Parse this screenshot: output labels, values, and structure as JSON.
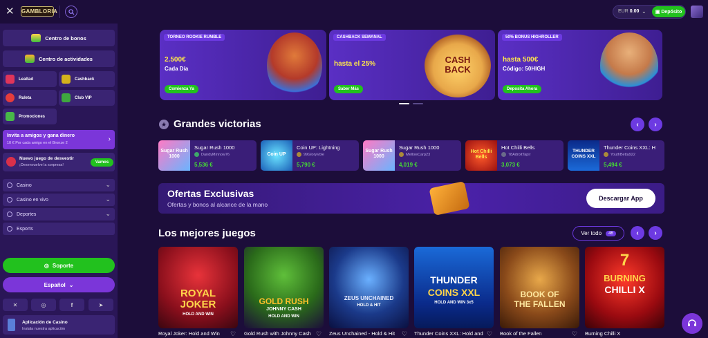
{
  "header": {
    "logo": "GAMBLORIA",
    "balance_label": "EUR",
    "balance_value": "0.00",
    "deposit_label": "Depósito"
  },
  "sidebar": {
    "bonus_center": "Centro de bonos",
    "activity_center": "Centro de actividades",
    "tiles": [
      "Lealtad",
      "Cashback",
      "Ruleta",
      "Club VIP",
      "Promociones"
    ],
    "invite_title": "Invita a amigos y gana dinero",
    "invite_sub": "10 € Por cada amigo en el Bronze 2",
    "wheel_title": "Nuevo juego de desvestir",
    "wheel_sub": "¡Desenvuelve la sorpresa!",
    "wheel_button": "Vamos",
    "menu": [
      "Casino",
      "Casino en vivo",
      "Deportes",
      "Esports"
    ],
    "support": "Soporte",
    "language": "Español",
    "app_title": "Aplicación de Casino",
    "app_sub": "Instala nuestra aplicación"
  },
  "promos": [
    {
      "tag": "TORNEO ROOKIE RUMBLE",
      "line1": "2.500€",
      "line2": "Cada Día",
      "cta": "Comienza Ya"
    },
    {
      "tag": "CASHBACK SEMANAL",
      "line1": "hasta el 25%",
      "line2": "",
      "cta": "Saber Más",
      "art_text": "CASH BACK"
    },
    {
      "tag": "50% BONUS HIGHROLLER",
      "line1": "hasta 500€",
      "line2": "Código: 50HIGH",
      "cta": "Deposita Ahora"
    }
  ],
  "big_wins": {
    "title": "Grandes victorias",
    "items": [
      {
        "game": "Sugar Rush 1000",
        "user": "DandyMinnow76",
        "amount": "5,536 €",
        "thumb": "Sugar Rush 1000"
      },
      {
        "game": "Coin UP: Lightning",
        "user": "99GloryVole",
        "amount": "5,790 €",
        "thumb": "Coin UP"
      },
      {
        "game": "Sugar Rush 1000",
        "user": "MellowCarp23",
        "amount": "4,019 €",
        "thumb": "Sugar Rush 1000"
      },
      {
        "game": "Hot Chilli Bells",
        "user": "78AdroitTapir",
        "amount": "3,073 €",
        "thumb": "Hot Chilli Bells"
      },
      {
        "game": "Thunder Coins XXL: H",
        "user": "YouthBetta922",
        "amount": "5,494 €",
        "thumb": "THUNDER COINS XXL"
      }
    ]
  },
  "offer": {
    "title": "Ofertas Exclusivas",
    "subtitle": "Ofertas y bonos al alcance de la mano",
    "button": "Descargar App"
  },
  "top_games": {
    "title": "Los mejores juegos",
    "view_all": "Ver todo",
    "count": "46",
    "items": [
      {
        "name": "Royal Joker: Hold and Win",
        "art1": "ROYAL",
        "art2": "JOKER",
        "art3": "HOLD AND WIN"
      },
      {
        "name": "Gold Rush with Johnny Cash",
        "art1": "GOLD RUSH",
        "art2": "JOHNNY CASH",
        "art3": "HOLD AND WIN"
      },
      {
        "name": "Zeus Unchained - Hold & Hit",
        "art1": "ZEUS UNCHAINED",
        "art2": "HOLD & HIT",
        "art3": ""
      },
      {
        "name": "Thunder Coins XXL: Hold and Win",
        "art1": "THUNDER",
        "art2": "COINS XXL",
        "art3": "HOLD AND WIN 3x5"
      },
      {
        "name": "Book of the Fallen",
        "art1": "BOOK OF",
        "art2": "THE FALLEN",
        "art3": ""
      },
      {
        "name": "Burning Chilli X",
        "art1": "7",
        "art2": "BURNING",
        "art3": "CHILLI X"
      }
    ]
  }
}
